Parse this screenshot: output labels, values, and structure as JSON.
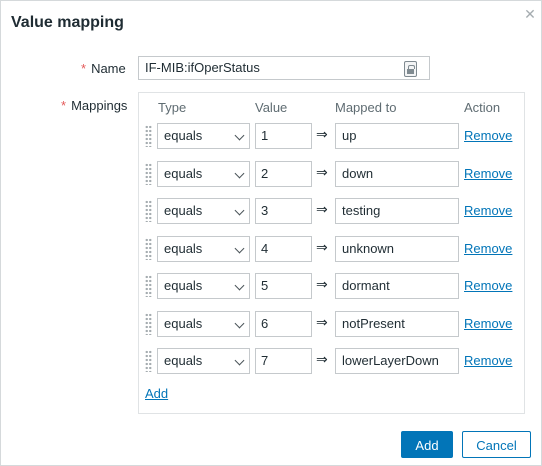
{
  "dialog": {
    "title": "Value mapping",
    "close_icon": "close-icon"
  },
  "form": {
    "name_label": "Name",
    "name_value": "IF-MIB:ifOperStatus",
    "mappings_label": "Mappings"
  },
  "table": {
    "headers": {
      "type": "Type",
      "value": "Value",
      "mapped_to": "Mapped to",
      "action": "Action"
    },
    "rows": [
      {
        "type": "equals",
        "value": "1",
        "mapped_to": "up",
        "action": "Remove"
      },
      {
        "type": "equals",
        "value": "2",
        "mapped_to": "down",
        "action": "Remove"
      },
      {
        "type": "equals",
        "value": "3",
        "mapped_to": "testing",
        "action": "Remove"
      },
      {
        "type": "equals",
        "value": "4",
        "mapped_to": "unknown",
        "action": "Remove"
      },
      {
        "type": "equals",
        "value": "5",
        "mapped_to": "dormant",
        "action": "Remove"
      },
      {
        "type": "equals",
        "value": "6",
        "mapped_to": "notPresent",
        "action": "Remove"
      },
      {
        "type": "equals",
        "value": "7",
        "mapped_to": "lowerLayerDown",
        "action": "Remove"
      }
    ],
    "arrow": "⇒",
    "add_label": "Add"
  },
  "footer": {
    "add_button": "Add",
    "cancel_button": "Cancel"
  },
  "colors": {
    "accent": "#0275b8",
    "required": "#e45959"
  }
}
